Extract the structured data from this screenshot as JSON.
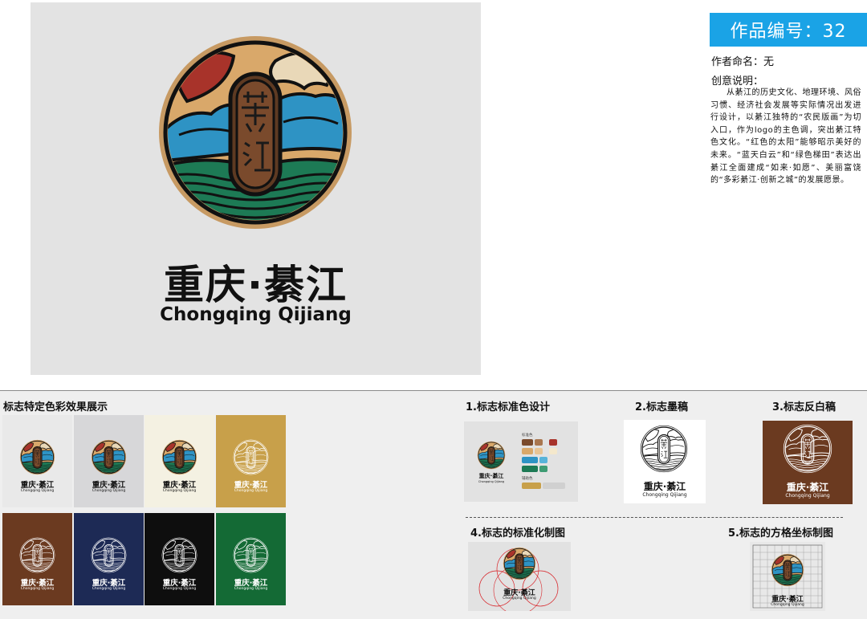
{
  "main": {
    "name": "重庆·綦江",
    "pinyin": "Chongqing Qijiang"
  },
  "info": {
    "work_number": "作品编号：32",
    "author": "作者命名：无",
    "desc_title": "创意说明：",
    "desc_body": "从綦江的历史文化、地理环境、风俗习惯、经济社会发展等实际情况出发进行设计，以綦江独特的“农民版画”为切入口，作为logo的主色调，突出綦江特色文化。“红色的太阳”能够昭示美好的未来。“蓝天白云”和“绿色梯田”表达出綦江全面建成“如来·如愿”、美丽富饶的“多彩綦江·创新之城”的发展愿景。"
  },
  "lower": {
    "color_effects_title": "标志特定色彩效果展示",
    "tiles": [
      {
        "bg": "#e9e9e9",
        "mode": "color",
        "text": "#111111"
      },
      {
        "bg": "#d7d7d9",
        "mode": "color",
        "text": "#111111"
      },
      {
        "bg": "#f4f1e2",
        "mode": "color",
        "text": "#111111"
      },
      {
        "bg": "#c8a04a",
        "mode": "mono",
        "text": "#ffffff"
      },
      {
        "bg": "#6b3a20",
        "mode": "mono",
        "text": "#ffffff"
      },
      {
        "bg": "#1d2a55",
        "mode": "mono",
        "text": "#ffffff"
      },
      {
        "bg": "#0e0e0e",
        "mode": "mono",
        "text": "#ffffff"
      },
      {
        "bg": "#146a35",
        "mode": "mono",
        "text": "#ffffff"
      }
    ],
    "sections": {
      "std_color": "1.标志标准色设计",
      "ink": "2.标志墨稿",
      "reverse": "3.标志反白稿",
      "standard_drawing": "4.标志的标准化制图",
      "grid_drawing": "5.标志的方格坐标制图"
    },
    "std_labels": {
      "standard": "标准色",
      "auxiliary": "辅助色"
    }
  },
  "colors": {
    "accent_blue": "#1aa3e6",
    "logo_tan": "#d9a86a",
    "logo_red": "#a8332a",
    "logo_blue": "#2e93c4",
    "logo_green": "#1d7a55",
    "logo_brown": "#7a4a2c",
    "reverse_bg": "#6b3a20"
  }
}
